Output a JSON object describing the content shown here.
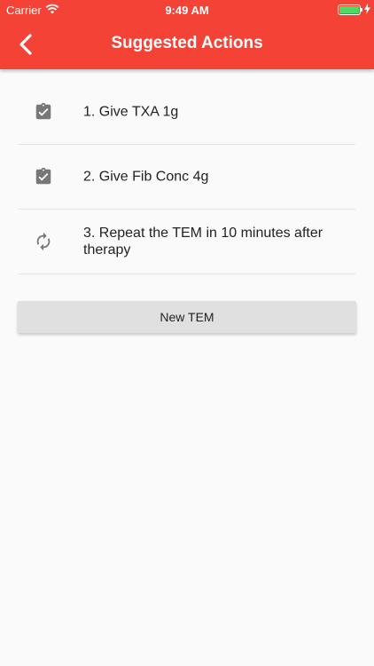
{
  "status_bar": {
    "carrier": "Carrier",
    "time": "9:49 AM",
    "battery_color": "#4cd964"
  },
  "app_bar": {
    "title": "Suggested Actions",
    "back_icon": "chevron-left-icon",
    "background": "#f44336"
  },
  "actions": [
    {
      "label": "1. Give TXA 1g",
      "icon": "clipboard-check-icon"
    },
    {
      "label": "2. Give Fib Conc 4g",
      "icon": "clipboard-check-icon"
    },
    {
      "label": "3. Repeat the TEM in 10 minutes after therapy",
      "icon": "refresh-icon"
    }
  ],
  "new_tem_button": {
    "label": "New TEM"
  }
}
